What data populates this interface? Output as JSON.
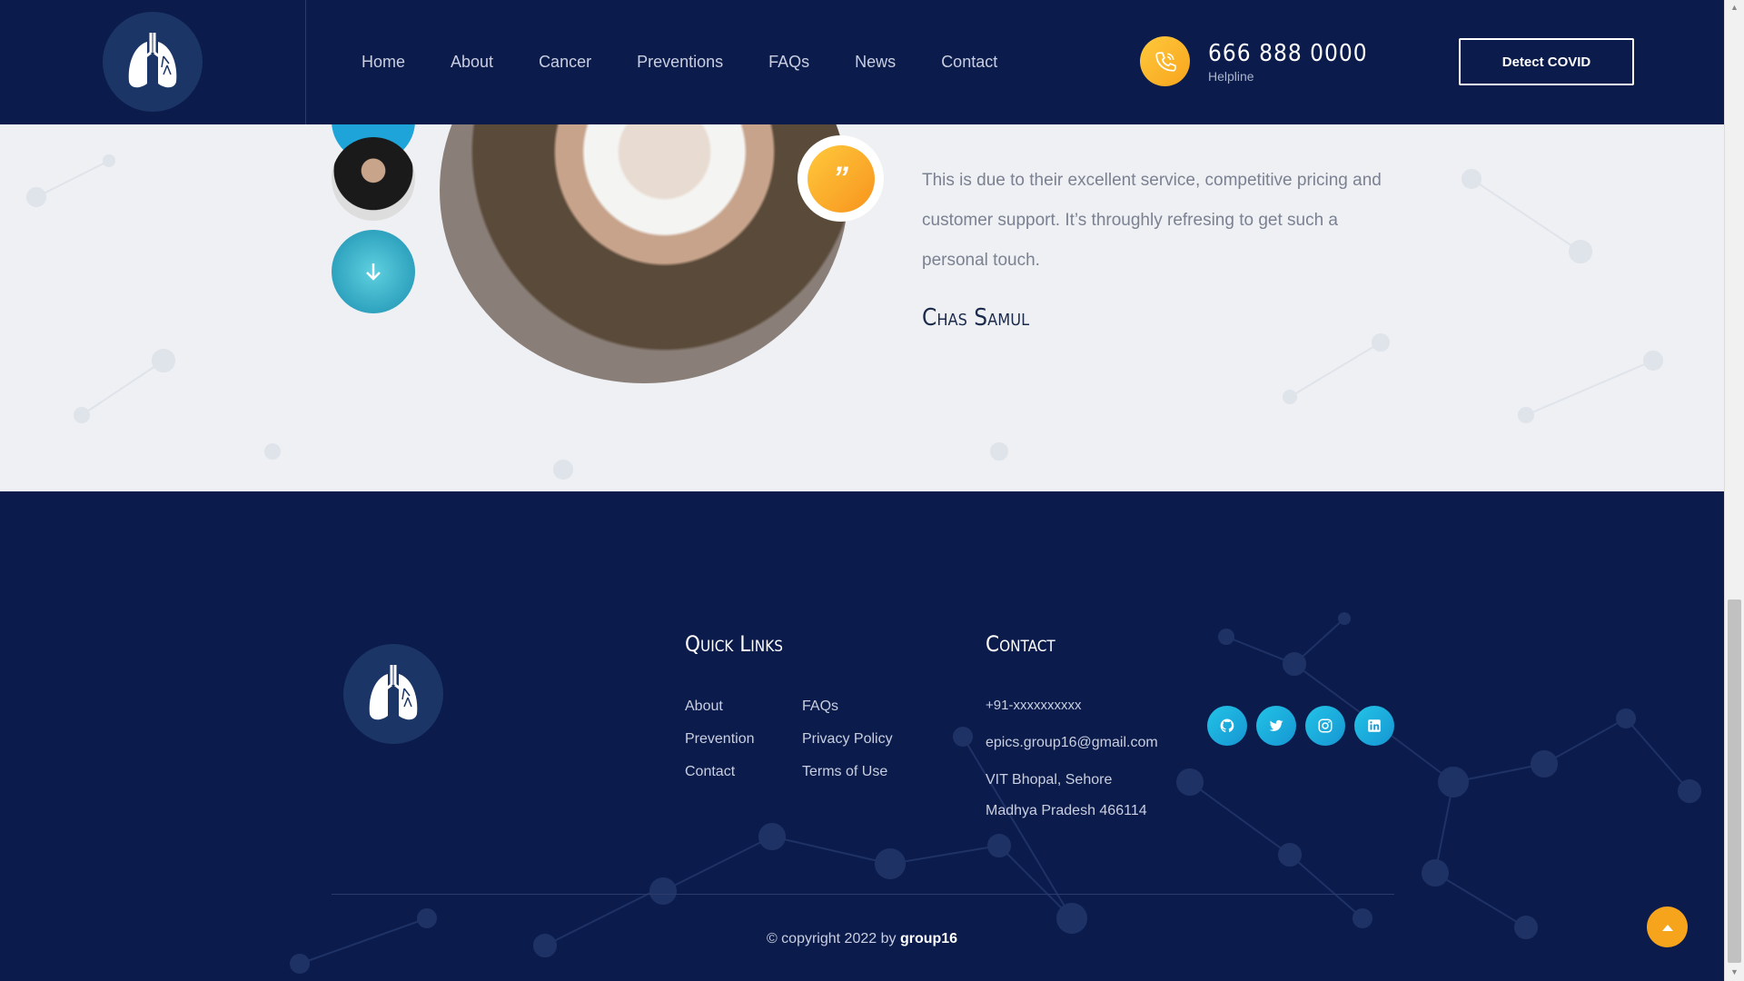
{
  "header": {
    "nav": [
      "Home",
      "About",
      "Cancer",
      "Preventions",
      "FAQs",
      "News",
      "Contact"
    ],
    "helpline_number": "666 888 0000",
    "helpline_label": "Helpline",
    "detect_button": "Detect COVID"
  },
  "testimonial": {
    "quote_mark": "”",
    "text": "This is due to their excellent service, competitive pricing and customer support. It’s throughly refresing to get such a personal touch.",
    "author": "Chas Samul"
  },
  "footer": {
    "quick_links_title": "Quick Links",
    "quick_links": [
      [
        "About",
        "FAQs"
      ],
      [
        "Prevention",
        "Privacy Policy"
      ],
      [
        "Contact",
        "Terms of Use"
      ]
    ],
    "contact_title": "Contact",
    "phone": "+91-xxxxxxxxxx",
    "email": "epics.group16@gmail.com",
    "address_line1": "VIT Bhopal, Sehore",
    "address_line2": "Madhya Pradesh 466114",
    "social": [
      "github-icon",
      "twitter-icon",
      "instagram-icon",
      "linkedin-icon"
    ],
    "copyright_prefix": "© copyright 2022 by",
    "copyright_owner": "group16"
  },
  "colors": {
    "navy": "#0b1b4b",
    "accent_orange": "#f7a41d",
    "accent_cyan": "#1ea4d8"
  }
}
